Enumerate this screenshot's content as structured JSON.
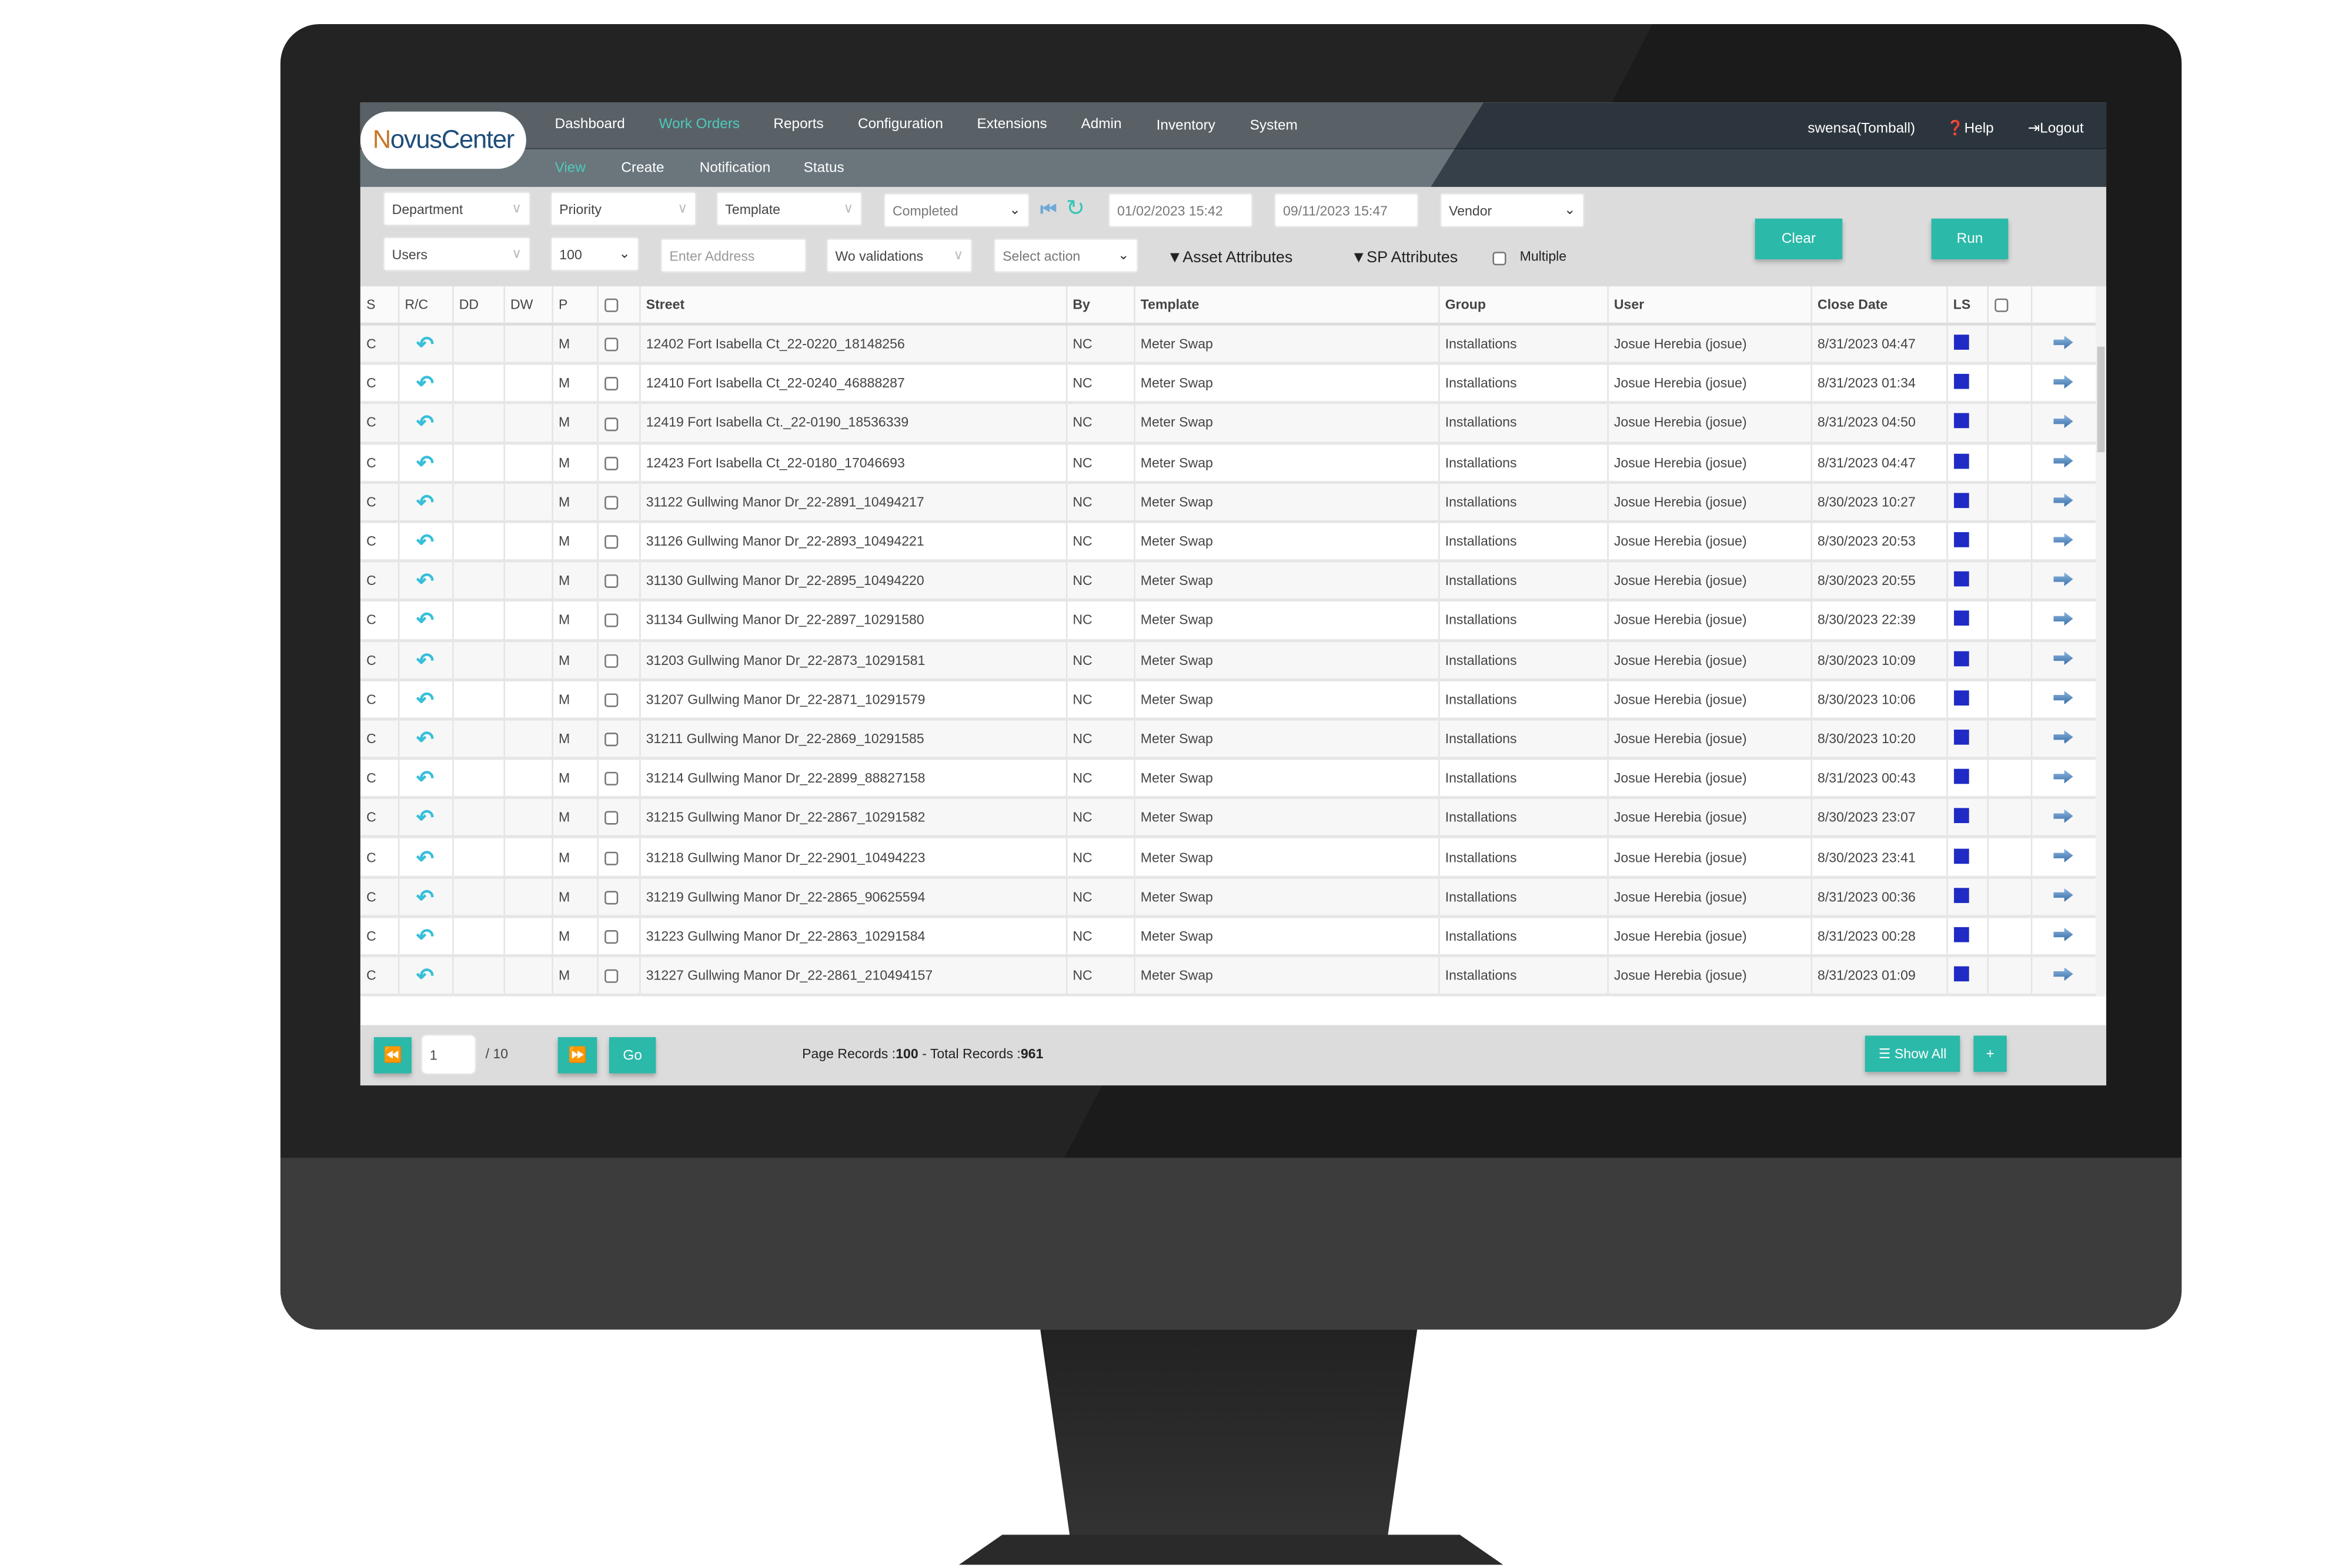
{
  "app": {
    "logo": "NovusCenter",
    "logo_first": "N",
    "logo_rest": "ovusCenter",
    "accent": "#2bb9a9"
  },
  "nav": {
    "items": [
      "Dashboard",
      "Work Orders",
      "Reports",
      "Configuration",
      "Extensions",
      "Admin",
      "Inventory",
      "System"
    ],
    "active": "Work Orders",
    "user": "swensa(Tomball)",
    "help": "Help",
    "logout": "Logout"
  },
  "subnav": {
    "items": [
      "View",
      "Create",
      "Notification",
      "Status"
    ],
    "active": "View"
  },
  "filters": {
    "department": "Department",
    "priority": "Priority",
    "template": "Template",
    "status": "Completed",
    "start_date": "01/02/2023 15:42",
    "end_date": "09/11/2023 15:47",
    "vendor": "Vendor",
    "users": "Users",
    "page_size": "100",
    "address_placeholder": "Enter Address",
    "validations": "Wo validations",
    "action": "Select action",
    "asset_attributes": "Asset Attributes",
    "sp_attributes": "SP Attributes",
    "multiple": "Multiple",
    "clear": "Clear",
    "run": "Run"
  },
  "table": {
    "columns": [
      "S",
      "R/C",
      "DD",
      "DW",
      "P",
      "",
      "Street",
      "By",
      "Template",
      "Group",
      "User",
      "Close Date",
      "LS",
      "",
      ""
    ],
    "rows": [
      {
        "s": "C",
        "p": "M",
        "street": "12402 Fort Isabella Ct_22-0220_18148256",
        "by": "NC",
        "template": "Meter Swap",
        "group": "Installations",
        "user": "Josue Herebia (josue)",
        "close": "8/31/2023 04:47"
      },
      {
        "s": "C",
        "p": "M",
        "street": "12410 Fort Isabella Ct_22-0240_46888287",
        "by": "NC",
        "template": "Meter Swap",
        "group": "Installations",
        "user": "Josue Herebia (josue)",
        "close": "8/31/2023 01:34"
      },
      {
        "s": "C",
        "p": "M",
        "street": "12419 Fort Isabella Ct._22-0190_18536339",
        "by": "NC",
        "template": "Meter Swap",
        "group": "Installations",
        "user": "Josue Herebia (josue)",
        "close": "8/31/2023 04:50"
      },
      {
        "s": "C",
        "p": "M",
        "street": "12423 Fort Isabella Ct_22-0180_17046693",
        "by": "NC",
        "template": "Meter Swap",
        "group": "Installations",
        "user": "Josue Herebia (josue)",
        "close": "8/31/2023 04:47"
      },
      {
        "s": "C",
        "p": "M",
        "street": "31122 Gullwing Manor Dr_22-2891_10494217",
        "by": "NC",
        "template": "Meter Swap",
        "group": "Installations",
        "user": "Josue Herebia (josue)",
        "close": "8/30/2023 10:27"
      },
      {
        "s": "C",
        "p": "M",
        "street": "31126 Gullwing Manor Dr_22-2893_10494221",
        "by": "NC",
        "template": "Meter Swap",
        "group": "Installations",
        "user": "Josue Herebia (josue)",
        "close": "8/30/2023 20:53"
      },
      {
        "s": "C",
        "p": "M",
        "street": "31130 Gullwing Manor Dr_22-2895_10494220",
        "by": "NC",
        "template": "Meter Swap",
        "group": "Installations",
        "user": "Josue Herebia (josue)",
        "close": "8/30/2023 20:55"
      },
      {
        "s": "C",
        "p": "M",
        "street": "31134 Gullwing Manor Dr_22-2897_10291580",
        "by": "NC",
        "template": "Meter Swap",
        "group": "Installations",
        "user": "Josue Herebia (josue)",
        "close": "8/30/2023 22:39"
      },
      {
        "s": "C",
        "p": "M",
        "street": "31203 Gullwing Manor Dr_22-2873_10291581",
        "by": "NC",
        "template": "Meter Swap",
        "group": "Installations",
        "user": "Josue Herebia (josue)",
        "close": "8/30/2023 10:09"
      },
      {
        "s": "C",
        "p": "M",
        "street": "31207 Gullwing Manor Dr_22-2871_10291579",
        "by": "NC",
        "template": "Meter Swap",
        "group": "Installations",
        "user": "Josue Herebia (josue)",
        "close": "8/30/2023 10:06"
      },
      {
        "s": "C",
        "p": "M",
        "street": "31211 Gullwing Manor Dr_22-2869_10291585",
        "by": "NC",
        "template": "Meter Swap",
        "group": "Installations",
        "user": "Josue Herebia (josue)",
        "close": "8/30/2023 10:20"
      },
      {
        "s": "C",
        "p": "M",
        "street": "31214 Gullwing Manor Dr_22-2899_88827158",
        "by": "NC",
        "template": "Meter Swap",
        "group": "Installations",
        "user": "Josue Herebia (josue)",
        "close": "8/31/2023 00:43"
      },
      {
        "s": "C",
        "p": "M",
        "street": "31215 Gullwing Manor Dr_22-2867_10291582",
        "by": "NC",
        "template": "Meter Swap",
        "group": "Installations",
        "user": "Josue Herebia (josue)",
        "close": "8/30/2023 23:07"
      },
      {
        "s": "C",
        "p": "M",
        "street": "31218 Gullwing Manor Dr_22-2901_10494223",
        "by": "NC",
        "template": "Meter Swap",
        "group": "Installations",
        "user": "Josue Herebia (josue)",
        "close": "8/30/2023 23:41"
      },
      {
        "s": "C",
        "p": "M",
        "street": "31219 Gullwing Manor Dr_22-2865_90625594",
        "by": "NC",
        "template": "Meter Swap",
        "group": "Installations",
        "user": "Josue Herebia (josue)",
        "close": "8/31/2023 00:36"
      },
      {
        "s": "C",
        "p": "M",
        "street": "31223 Gullwing Manor Dr_22-2863_10291584",
        "by": "NC",
        "template": "Meter Swap",
        "group": "Installations",
        "user": "Josue Herebia (josue)",
        "close": "8/31/2023 00:28"
      },
      {
        "s": "C",
        "p": "M",
        "street": "31227 Gullwing Manor Dr_22-2861_210494157",
        "by": "NC",
        "template": "Meter Swap",
        "group": "Installations",
        "user": "Josue Herebia (josue)",
        "close": "8/31/2023 01:09"
      }
    ],
    "ls_color": "#1f2bc4",
    "rc_icon": "undo-arrow-icon",
    "row_action_icon": "arrow-right-icon"
  },
  "footer": {
    "page": "1",
    "total_pages": "/ 10",
    "go": "Go",
    "page_records_label": "Page Records :",
    "page_records": "100",
    "separator": "-",
    "total_records_label": "Total Records :",
    "total_records": "961",
    "show_all": "Show All",
    "add": "+"
  }
}
